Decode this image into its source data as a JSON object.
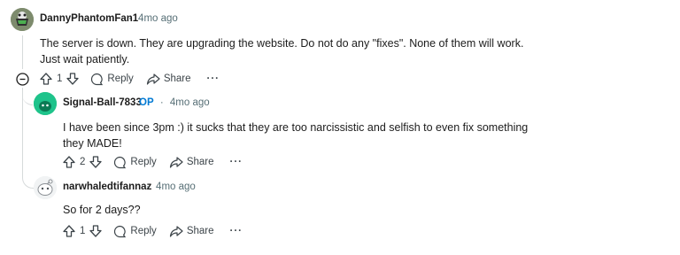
{
  "comments": [
    {
      "username": "DannyPhantomFan1",
      "time": "4mo ago",
      "text": "The server is down. They are upgrading the website. Do not do any \"fixes\". None of them will work. Just wait patiently.",
      "votes": "1",
      "reply_label": "Reply",
      "share_label": "Share",
      "more_label": "···"
    },
    {
      "username": "Signal-Ball-7833",
      "op_badge": "OP",
      "time": "4mo ago",
      "text": "I have been since 3pm :) it sucks that they are too narcissistic and selfish to even fix something they MADE!",
      "votes": "2",
      "reply_label": "Reply",
      "share_label": "Share",
      "more_label": "···"
    },
    {
      "username": "narwhaledtifannaz",
      "time": "4mo ago",
      "text": "So for 2 days??",
      "votes": "1",
      "reply_label": "Reply",
      "share_label": "Share",
      "more_label": "···"
    }
  ],
  "separator": "·",
  "colors": {
    "op": "#0079d3",
    "meta": "#576f76",
    "thread_line": "#d6dadb"
  }
}
